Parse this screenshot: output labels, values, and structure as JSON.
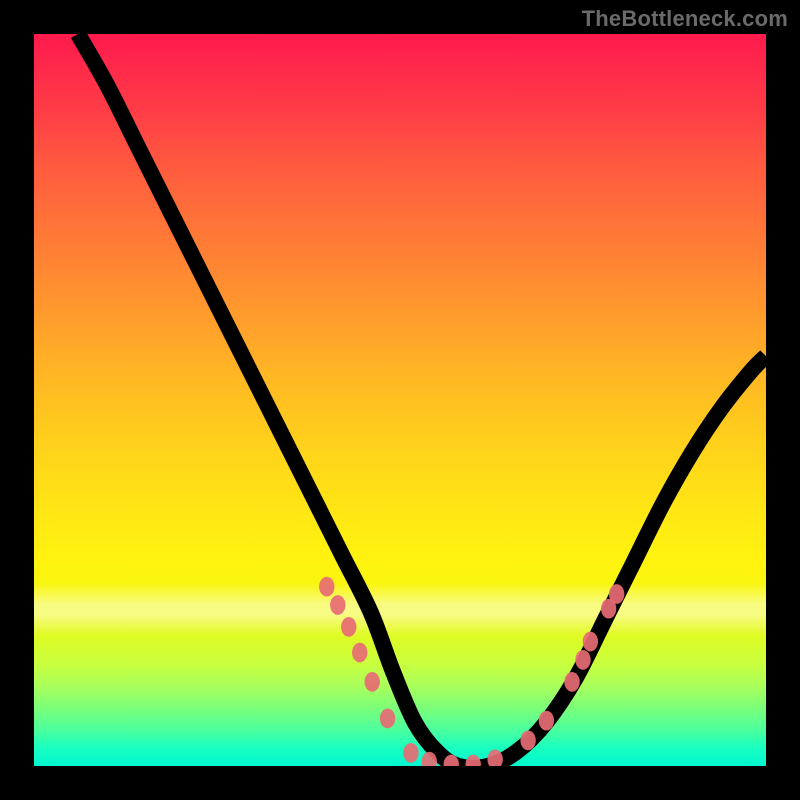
{
  "watermark": "TheBottleneck.com",
  "chart_data": {
    "type": "line",
    "title": "",
    "xlabel": "",
    "ylabel": "",
    "xlim": [
      0,
      100
    ],
    "ylim": [
      0,
      100
    ],
    "grid": false,
    "legend": false,
    "series": [
      {
        "name": "curve",
        "x": [
          6,
          10,
          14,
          18,
          22,
          26,
          30,
          34,
          38,
          42,
          46,
          49,
          52,
          55,
          58,
          62,
          66,
          70,
          74,
          78,
          82,
          86,
          90,
          94,
          98,
          100
        ],
        "y": [
          100,
          93,
          85,
          77,
          69,
          61,
          53,
          45,
          37,
          29,
          21,
          13,
          6,
          2,
          0,
          0,
          2,
          6,
          12,
          20,
          28,
          36,
          43,
          49,
          54,
          56
        ]
      }
    ],
    "markers": [
      {
        "x": 40.0,
        "y": 24.5
      },
      {
        "x": 41.5,
        "y": 22.0
      },
      {
        "x": 43.0,
        "y": 19.0
      },
      {
        "x": 44.5,
        "y": 15.5
      },
      {
        "x": 46.2,
        "y": 11.5
      },
      {
        "x": 48.3,
        "y": 6.5
      },
      {
        "x": 51.5,
        "y": 1.8
      },
      {
        "x": 54.0,
        "y": 0.6
      },
      {
        "x": 57.0,
        "y": 0.2
      },
      {
        "x": 60.0,
        "y": 0.2
      },
      {
        "x": 63.0,
        "y": 0.9
      },
      {
        "x": 67.5,
        "y": 3.5
      },
      {
        "x": 70.0,
        "y": 6.2
      },
      {
        "x": 73.5,
        "y": 11.5
      },
      {
        "x": 75.0,
        "y": 14.5
      },
      {
        "x": 76.0,
        "y": 17.0
      },
      {
        "x": 78.5,
        "y": 21.5
      },
      {
        "x": 79.6,
        "y": 23.5
      }
    ],
    "gradient_stops": [
      {
        "pos": 0,
        "color": "#ff1a4d"
      },
      {
        "pos": 0.5,
        "color": "#ffd61a"
      },
      {
        "pos": 0.8,
        "color": "#f2f70e"
      },
      {
        "pos": 1.0,
        "color": "#00f7cf"
      }
    ],
    "pale_band_y": [
      18,
      25
    ]
  }
}
